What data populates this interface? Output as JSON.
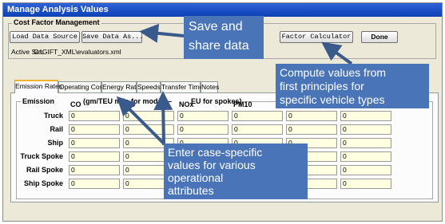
{
  "window": {
    "title": "Manage Analysis Values"
  },
  "cost_factor": {
    "legend": "Cost Factor Management",
    "load_label": "Load Data Source",
    "save_label": "Save Data As...",
    "active_set_label": "Active Set:",
    "active_set_value": "C:\\GIFT_XML\\evaluators.xml",
    "factor_calc_label": "Factor Calculator",
    "done_label": "Done"
  },
  "tabs": [
    {
      "label": "Emission Rates",
      "active": true
    },
    {
      "label": "Operating Cost",
      "active": false
    },
    {
      "label": "Energy Rate",
      "active": false
    },
    {
      "label": "Speeds",
      "active": false
    },
    {
      "label": "Transfer Times",
      "active": false
    },
    {
      "label": "Notes",
      "active": false
    }
  ],
  "emission": {
    "legend_prefix": "Emission",
    "legend_mid": "(gm/TEU mile for modes –",
    "legend_end": "EU for spokes)",
    "columns": [
      "CO",
      "CO",
      "NOx",
      "PM10",
      "",
      ""
    ],
    "rows": [
      {
        "label": "Truck",
        "values": [
          "0",
          "0",
          "0",
          "0",
          "0",
          "0"
        ]
      },
      {
        "label": "Rail",
        "values": [
          "0",
          "0",
          "0",
          "0",
          "0",
          "0"
        ]
      },
      {
        "label": "Ship",
        "values": [
          "0",
          "0",
          "0",
          "0",
          "0",
          "0"
        ]
      },
      {
        "label": "Truck Spoke",
        "values": [
          "0",
          "0",
          "0",
          "0",
          "0",
          "0"
        ]
      },
      {
        "label": "Rail Spoke",
        "values": [
          "0",
          "0",
          "0",
          "0",
          "0",
          "0"
        ]
      },
      {
        "label": "Ship Spoke",
        "values": [
          "0",
          "0",
          "0",
          "0",
          "0",
          "0"
        ]
      }
    ]
  },
  "callouts": {
    "save_share": [
      "Save and",
      "share data"
    ],
    "compute": [
      "Compute values from",
      "first principles for",
      "specific vehicle types"
    ],
    "enter": [
      "Enter case-specific",
      "values for various",
      "operational",
      "attributes"
    ]
  },
  "colors": {
    "callout_bg": "#4a74b8",
    "arrow": "#3a5a8c",
    "titlebar": "#1d50c8",
    "cell_bg": "#ffffe1"
  }
}
